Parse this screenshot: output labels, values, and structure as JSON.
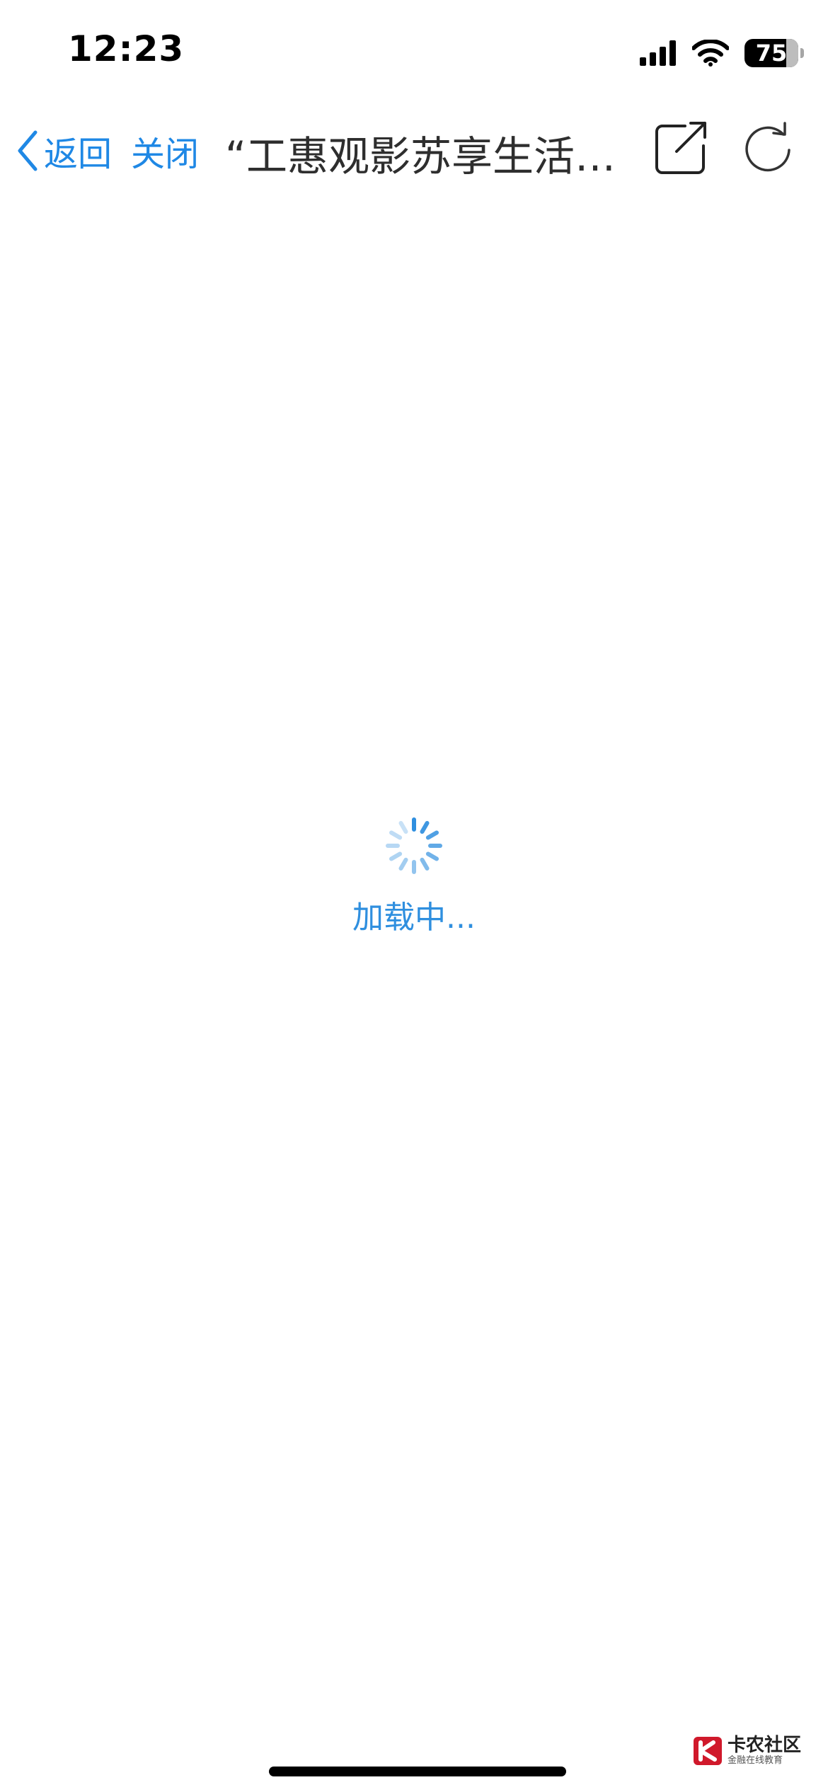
{
  "status_bar": {
    "time": "12:23",
    "battery_level": "75",
    "icons": [
      "signal-icon",
      "wifi-icon",
      "battery-icon"
    ]
  },
  "nav": {
    "back_label": "返回",
    "close_label": "关闭",
    "title": "“工惠观影苏享生活…",
    "icons": [
      "chevron-left-icon",
      "share-icon",
      "refresh-icon"
    ]
  },
  "loading": {
    "label": "加载中..."
  },
  "watermark": {
    "title": "卡农社区",
    "subtitle": "金融在线教育"
  },
  "colors": {
    "accent": "#1f88e5",
    "title_text": "#2e2e2e",
    "spinner": "#2f8fdf",
    "background": "#ffffff"
  }
}
